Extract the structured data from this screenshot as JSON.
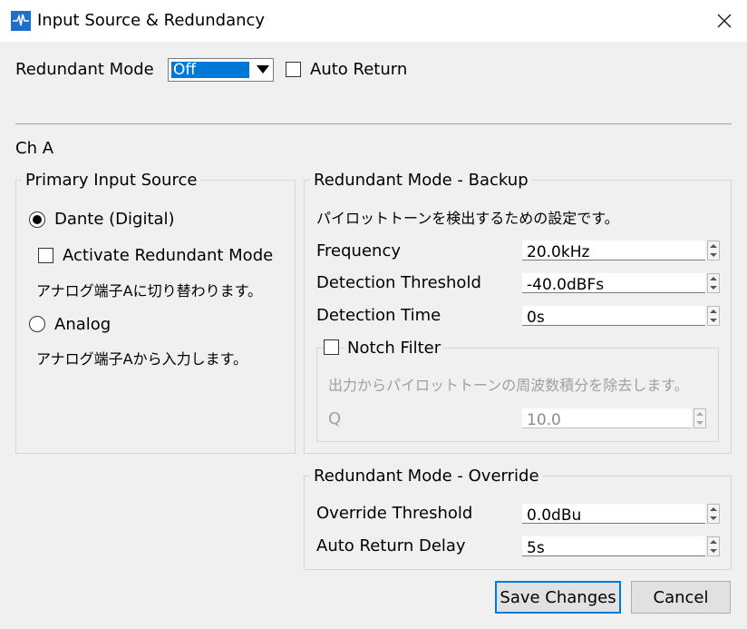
{
  "window": {
    "title": "Input Source & Redundancy",
    "app_icon": "waveform-app-icon",
    "close_icon": "close-icon"
  },
  "top": {
    "redundant_mode_label": "Redundant Mode",
    "redundant_mode_value": "Off",
    "auto_return_label": "Auto Return",
    "auto_return_checked": false
  },
  "channel": {
    "label": "Ch A"
  },
  "primary": {
    "title": "Primary Input Source",
    "dante_label": "Dante (Digital)",
    "dante_selected": true,
    "activate_redundant_label": "Activate Redundant Mode",
    "activate_redundant_checked": false,
    "activate_note": "アナログ端子Aに切り替わります。",
    "analog_label": "Analog",
    "analog_selected": false,
    "analog_note": "アナログ端子Aから入力します。"
  },
  "backup": {
    "title": "Redundant Mode - Backup",
    "description": "パイロットトーンを検出するための設定です。",
    "frequency_label": "Frequency",
    "frequency_value": "20.0kHz",
    "threshold_label": "Detection Threshold",
    "threshold_value": "-40.0dBFs",
    "time_label": "Detection Time",
    "time_value": "0s",
    "notch": {
      "label": "Notch Filter",
      "checked": false,
      "description": "出力からパイロットトーンの周波数積分を除去します。",
      "q_label": "Q",
      "q_value": "10.0"
    }
  },
  "override": {
    "title": "Redundant Mode - Override",
    "threshold_label": "Override Threshold",
    "threshold_value": "0.0dBu",
    "delay_label": "Auto Return Delay",
    "delay_value": "5s"
  },
  "footer": {
    "save_label": "Save Changes",
    "cancel_label": "Cancel"
  },
  "colors": {
    "accent": "#0078d7",
    "app_icon_bg": "#1e6fc9",
    "dialog_bg": "#f0f0f0"
  }
}
